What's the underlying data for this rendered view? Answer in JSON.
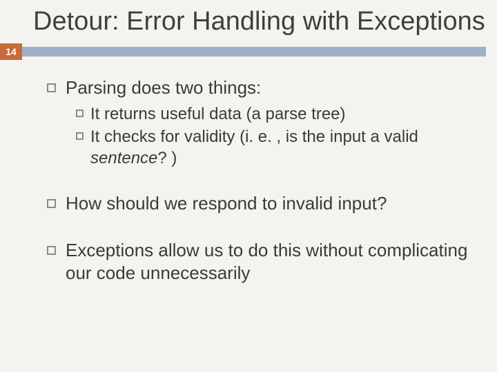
{
  "slide": {
    "title": "Detour: Error Handling with Exceptions",
    "number": "14",
    "bullets": [
      {
        "text": "Parsing does two things:",
        "subs": [
          {
            "lead": "It",
            "rest": " returns useful data (a parse tree)"
          },
          {
            "lead": "It",
            "rest_a": " checks for validity (i. e. , is the input a valid ",
            "italic": "sentence",
            "rest_b": "? )"
          }
        ]
      },
      {
        "text": "How should we respond to invalid input?"
      },
      {
        "italic_lead": "Exceptions",
        "rest": " allow us to do this without complicating our code unnecessarily"
      }
    ]
  }
}
